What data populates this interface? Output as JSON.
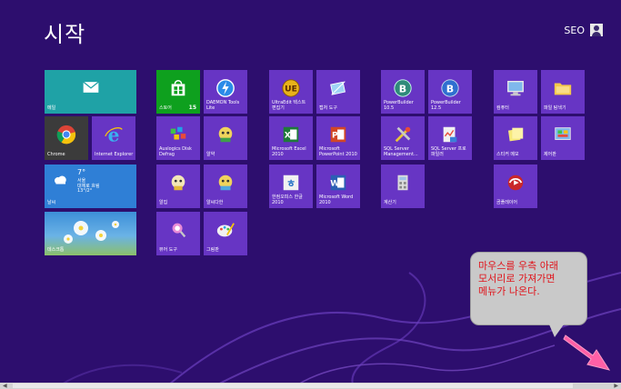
{
  "screen": {
    "title": "시작",
    "user_name": "SEO"
  },
  "tiles": {
    "mail": "메일",
    "store": "스토어",
    "store_badge": "15",
    "daemon": "DAEMON Tools\nLite",
    "ultraedit": "UltraEdit 텍스트\n편집기",
    "snip": "캡처 도구",
    "pb1": "PowerBuilder\n10.5",
    "pb2": "PowerBuilder\n12.5",
    "computer": "컴퓨터",
    "explorer": "파일 탐색기",
    "chrome": "Chrome",
    "ie": "Internet Explorer",
    "defrag": "Auslogics Disk\nDefrag",
    "app1": "알약",
    "excel": "Microsoft Excel\n2010",
    "ppt": "Microsoft\nPowerPoint 2010",
    "sql1": "SQL Server\nManagement...",
    "sql2": "SQL Server 프로\n파일러",
    "sticky": "스티커 메모",
    "control": "제어판",
    "weather_temp": "7°",
    "weather_city": "서울",
    "weather_cond": "대체로 흐림",
    "weather_range": "13°/2°",
    "weather": "날씨",
    "app2": "알집",
    "app3": "알씨다한",
    "hwp": "한컴오피스 한글\n2010",
    "word": "Microsoft Word\n2010",
    "calc": "계산기",
    "app4": "곰플레이어",
    "desktop": "데스크톱",
    "viewer": "뷰어 도구",
    "paint": "그림판"
  },
  "tooltip": {
    "text": "마우스를 우측 아래\n모서리로 가져가면\n메뉴가 나온다."
  },
  "colors": {
    "background": "#2d0e6e",
    "tile_purple": "#6735c4",
    "mail_teal": "#1fa2a6",
    "store_green": "#0ea01e",
    "weather_blue": "#2f7fd6",
    "tooltip_text": "#e0141b",
    "arrow_pink": "#ff5fa6"
  }
}
